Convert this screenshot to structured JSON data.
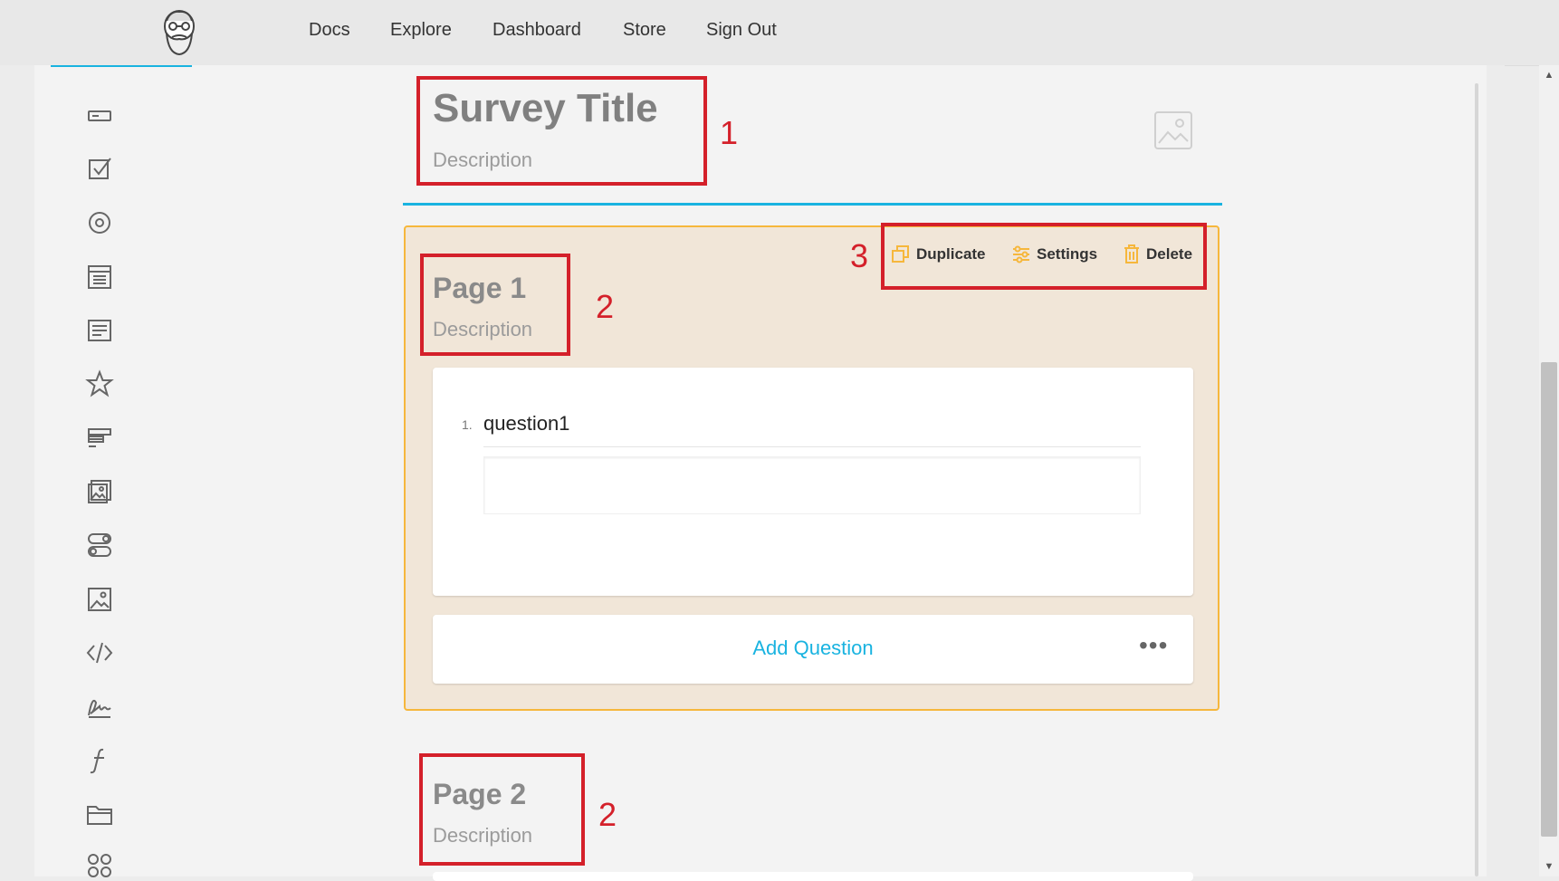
{
  "nav": {
    "links": [
      "Docs",
      "Explore",
      "Dashboard",
      "Store",
      "Sign Out"
    ]
  },
  "toolbox": {
    "icons": [
      "text-input-icon",
      "checkbox-icon",
      "radiogroup-icon",
      "dropdown-icon",
      "comment-icon",
      "rating-icon",
      "ranking-icon",
      "imagepicker-icon",
      "boolean-icon",
      "image-icon",
      "html-icon",
      "signaturepad-icon",
      "expression-icon",
      "file-icon",
      "matrix-icon"
    ]
  },
  "survey": {
    "title": "Survey Title",
    "description": "Description"
  },
  "page1": {
    "title": "Page 1",
    "description": "Description",
    "actions": {
      "duplicate": "Duplicate",
      "settings": "Settings",
      "delete": "Delete"
    },
    "question": {
      "number": "1.",
      "title": "question1",
      "value": ""
    },
    "add_question": "Add Question",
    "more": "•••"
  },
  "page2": {
    "title": "Page 2",
    "description": "Description"
  },
  "annotations": [
    "1",
    "2",
    "3",
    "2"
  ],
  "colors": {
    "accent": "#19b3e0",
    "page_border": "#f6b73c",
    "page_bg": "#f1e6d8",
    "action_icon": "#f6b73c",
    "annotation": "#d4202a"
  }
}
